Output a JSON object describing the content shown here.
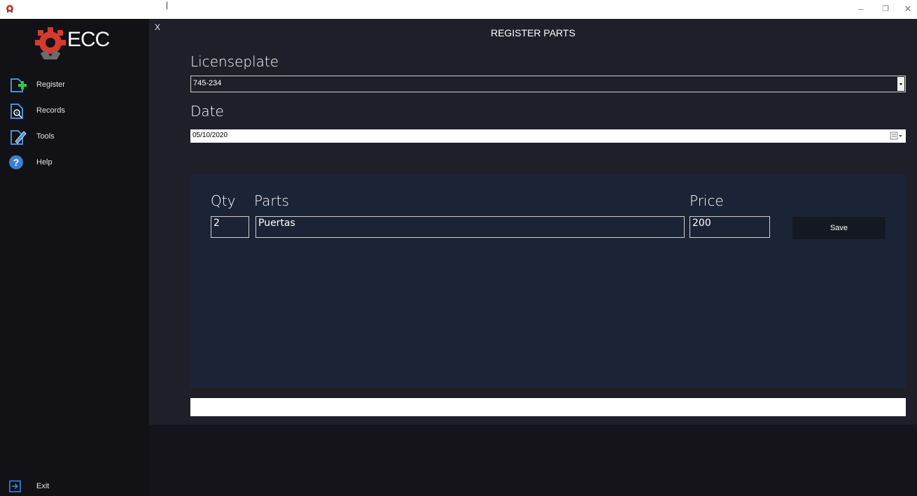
{
  "window": {
    "caption": "|",
    "minimize_glyph": "–",
    "restore_glyph": "❐",
    "close_glyph": "✕"
  },
  "sidebar": {
    "logo_text": "ECC",
    "items": [
      {
        "label": "Register",
        "icon": "register-icon"
      },
      {
        "label": "Records",
        "icon": "records-icon"
      },
      {
        "label": "Tools",
        "icon": "tools-icon"
      },
      {
        "label": "Help",
        "icon": "help-icon"
      }
    ],
    "exit_label": "Exit"
  },
  "main": {
    "close_label": "X",
    "title": "REGISTER PARTS",
    "licenseplate_label": "Licenseplate",
    "licenseplate_value": "745-234",
    "date_label": "Date",
    "date_value": "05/10/2020",
    "parts": {
      "qty_label": "Qty",
      "parts_label": "Parts",
      "price_label": "Price",
      "qty_value": "2",
      "parts_value": "Puertas",
      "price_value": "200",
      "save_label": "Save"
    }
  },
  "colors": {
    "sidebar_bg": "#111116",
    "main_bg": "#1f1f29",
    "panel_bg": "#1b2336",
    "accent_green": "#2ecc40",
    "logo_red": "#d63a2f"
  }
}
